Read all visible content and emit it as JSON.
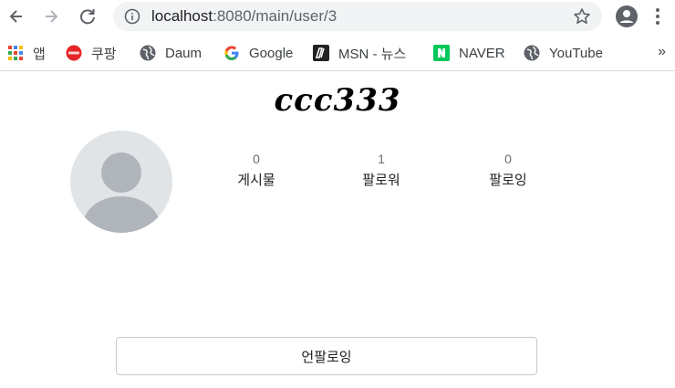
{
  "browser": {
    "url_host": "localhost",
    "url_path": ":8080/main/user/3"
  },
  "bookmarks": [
    {
      "label": "앱",
      "icon": "apps-grid-icon"
    },
    {
      "label": "쿠팡",
      "icon": "coupang-icon"
    },
    {
      "label": "Daum",
      "icon": "globe-icon"
    },
    {
      "label": "Google",
      "icon": "google-icon"
    },
    {
      "label": "MSN - 뉴스",
      "icon": "msn-icon"
    },
    {
      "label": "NAVER",
      "icon": "naver-icon"
    },
    {
      "label": "YouTube",
      "icon": "globe-icon"
    }
  ],
  "bookmarks_more": "»",
  "profile": {
    "username": "ccc333",
    "stats": [
      {
        "value": "0",
        "label": "게시물"
      },
      {
        "value": "1",
        "label": "팔로워"
      },
      {
        "value": "0",
        "label": "팔로잉"
      }
    ],
    "unfollow_label": "언팔로잉"
  }
}
